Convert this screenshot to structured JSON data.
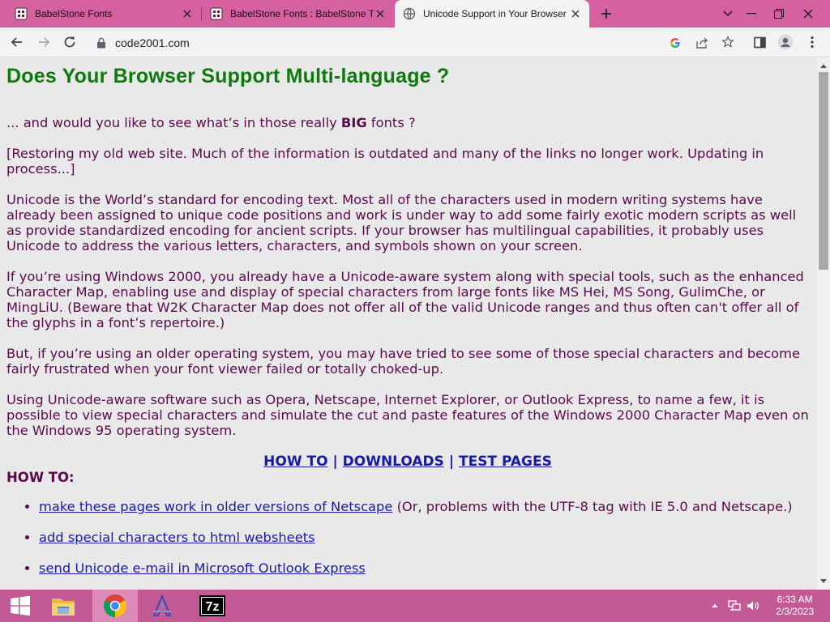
{
  "browser": {
    "tabs": [
      {
        "title": "BabelStone Fonts",
        "icon": "babelstone-favicon-icon",
        "active": false
      },
      {
        "title": "BabelStone Fonts : BabelStone Ti",
        "icon": "babelstone-favicon-icon",
        "active": false
      },
      {
        "title": "Unicode Support in Your Browser",
        "icon": "globe-icon",
        "active": true
      }
    ],
    "url": "code2001.com",
    "colors": {
      "tabstrip": "#d561a0",
      "toolbar": "#f3f3f3"
    }
  },
  "page": {
    "heading": "Does Your Browser Support Multi-language ?",
    "intro_before": "... and would you like to see what’s in those really ",
    "intro_big": "BIG",
    "intro_after": " fonts ?",
    "paragraphs": [
      "[Restoring my old web site. Much of the information is outdated and many of the links no longer work. Updating in process...]",
      "Unicode is the World’s standard for encoding text. Most all of the characters used in modern writing systems have already been assigned to unique code positions and work is under way to add some fairly exotic modern scripts as well as provide standardized encoding for ancient scripts. If your browser has multilingual capabilities, it probably uses Unicode to address the various letters, characters, and symbols shown on your screen.",
      "If you’re using Windows 2000, you already have a Unicode-aware system along with special tools, such as the enhanced Character Map, enabling use and display of special characters from large fonts like MS Hei, MS Song, GulimChe, or MingLiU. (Beware that W2K Character Map does not offer all of the valid Unicode ranges and thus often can't offer all of the glyphs in a font’s repertoire.)",
      "But, if you’re using an older operating system, you may have tried to see some of those special characters and become fairly frustrated when your font viewer failed or totally choked-up.",
      "Using Unicode-aware software such as Opera, Netscape, Internet Explorer, or Outlook Express, to name a few, it is possible to view special characters and simulate the cut and paste features of the Windows 2000 Character Map even on the Windows 95 operating system."
    ],
    "nav": {
      "howto": "HOW TO",
      "downloads": "DOWNLOADS",
      "testpages": "TEST PAGES",
      "separator": "|"
    },
    "howto_heading": "HOW TO:",
    "howto_items": [
      {
        "link": "make these pages work in older versions of Netscape",
        "note": " (Or, problems with the UTF-8 tag with IE 5.0 and Netscape.)"
      },
      {
        "link": "add special characters to html websheets",
        "note": ""
      },
      {
        "link": "send Unicode e-mail in Microsoft Outlook Express",
        "note": ""
      }
    ],
    "colors": {
      "heading": "#0e7a0e",
      "text": "#5a0a4a",
      "link": "#1a1aa8",
      "background": "#e9e9e9"
    }
  },
  "taskbar": {
    "pinned": [
      "file-explorer-icon",
      "chrome-icon",
      "font-app-icon",
      "7zip-icon"
    ],
    "clock_time": "6:33 AM",
    "clock_date": "2/3/2023",
    "color": "#c35a96"
  }
}
